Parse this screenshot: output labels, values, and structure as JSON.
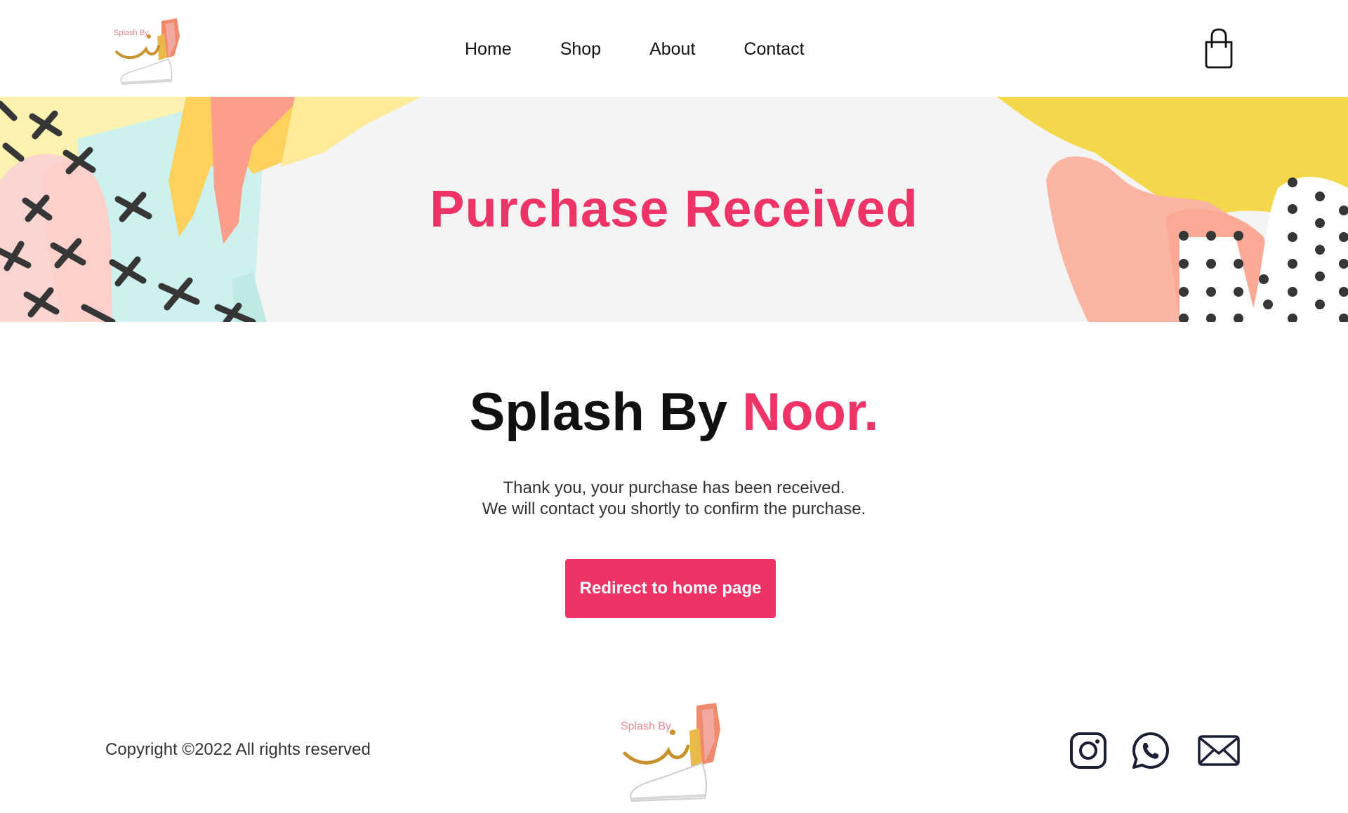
{
  "header": {
    "logo_alt": "Splash By Noor",
    "logo_text": "Splash By",
    "nav": [
      {
        "label": "Home",
        "icon": ""
      },
      {
        "label": "Shop",
        "icon": ""
      },
      {
        "label": "About",
        "icon": ""
      },
      {
        "label": "Contact",
        "icon": ""
      }
    ],
    "cart_icon": "shopping-bag-icon"
  },
  "banner": {
    "title": "Purchase Received"
  },
  "main": {
    "brand_primary": "Splash By ",
    "brand_accent": "Noor.",
    "message_line1": "Thank you, your purchase has been received.",
    "message_line2": "We will contact you shortly to confirm the purchase.",
    "redirect_button": "Redirect to home page"
  },
  "footer": {
    "copyright": "Copyright ©2022 All rights reserved",
    "logo_text": "Splash By",
    "social": [
      {
        "icon": "instagram-icon"
      },
      {
        "icon": "whatsapp-icon"
      },
      {
        "icon": "mail-icon"
      }
    ]
  },
  "colors": {
    "accent": "#ee3466",
    "text": "#111111",
    "banner_bg": "#f4f4f4",
    "yellow": "#f3d84c",
    "peach": "#fcb5a3",
    "cyan": "#cdf1ef",
    "orange": "#fdd25c",
    "salmon": "#fb9f8a",
    "pink": "#fcd5d0"
  }
}
